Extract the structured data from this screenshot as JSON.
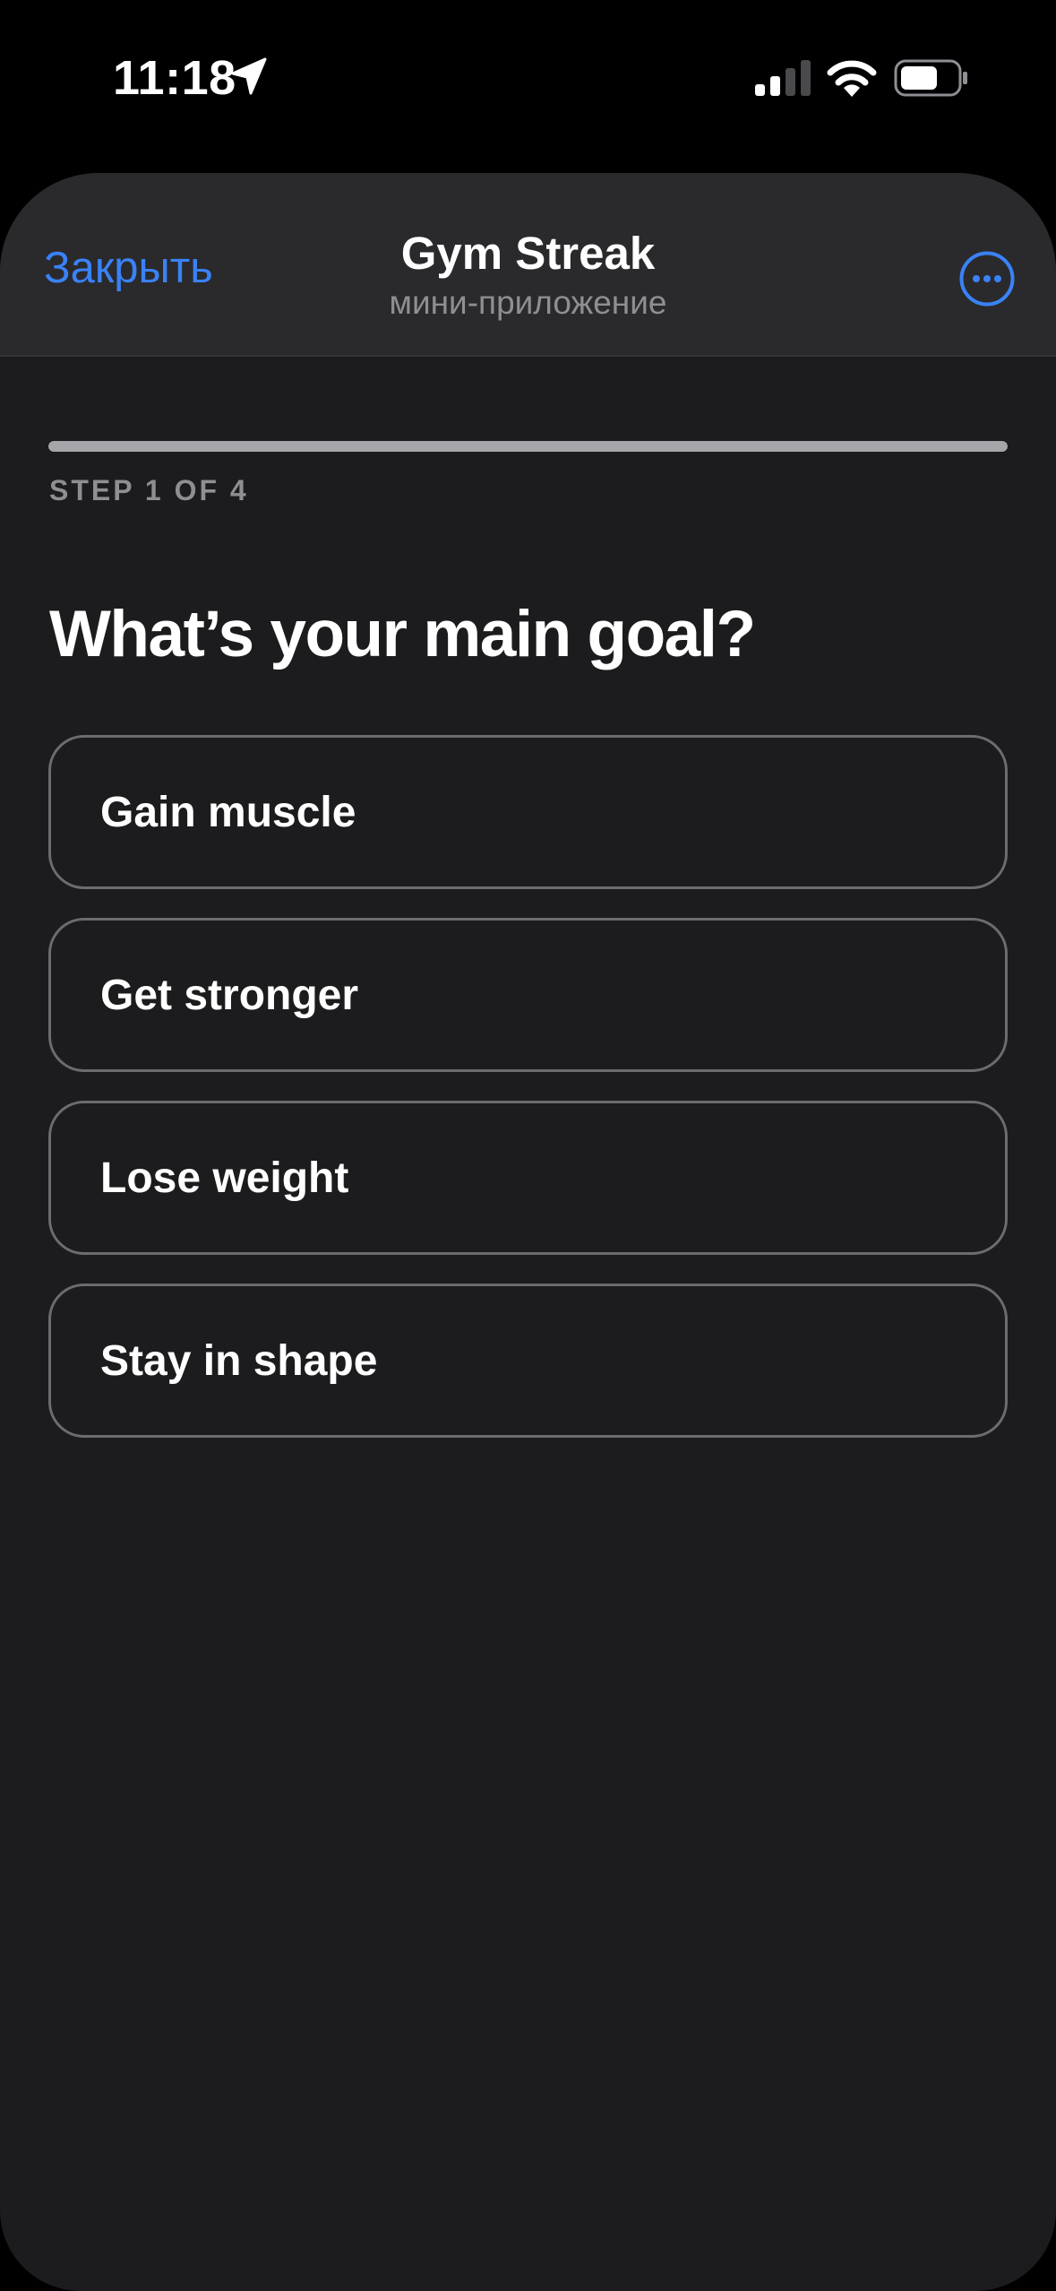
{
  "status_bar": {
    "time": "11:18",
    "icons": [
      "location-arrow-icon",
      "cellular-signal-icon",
      "wifi-icon",
      "battery-icon"
    ]
  },
  "header": {
    "close_label": "Закрыть",
    "title": "Gym Streak",
    "subtitle": "мини-приложение",
    "more_icon": "more-ellipsis-icon"
  },
  "progress": {
    "current_step": 1,
    "total_steps": 4,
    "step_label": "STEP 1 OF 4"
  },
  "question": "What’s your main goal?",
  "options": [
    {
      "label": "Gain muscle"
    },
    {
      "label": "Get stronger"
    },
    {
      "label": "Lose weight"
    },
    {
      "label": "Stay in shape"
    }
  ],
  "colors": {
    "background": "#000000",
    "sheet": "#1c1c1e",
    "header": "#2a2a2d",
    "accent": "#3a82f7",
    "secondary_text": "#8e8e93",
    "option_border": "#6b6b70",
    "progress_fill": "#a6a6aa"
  }
}
